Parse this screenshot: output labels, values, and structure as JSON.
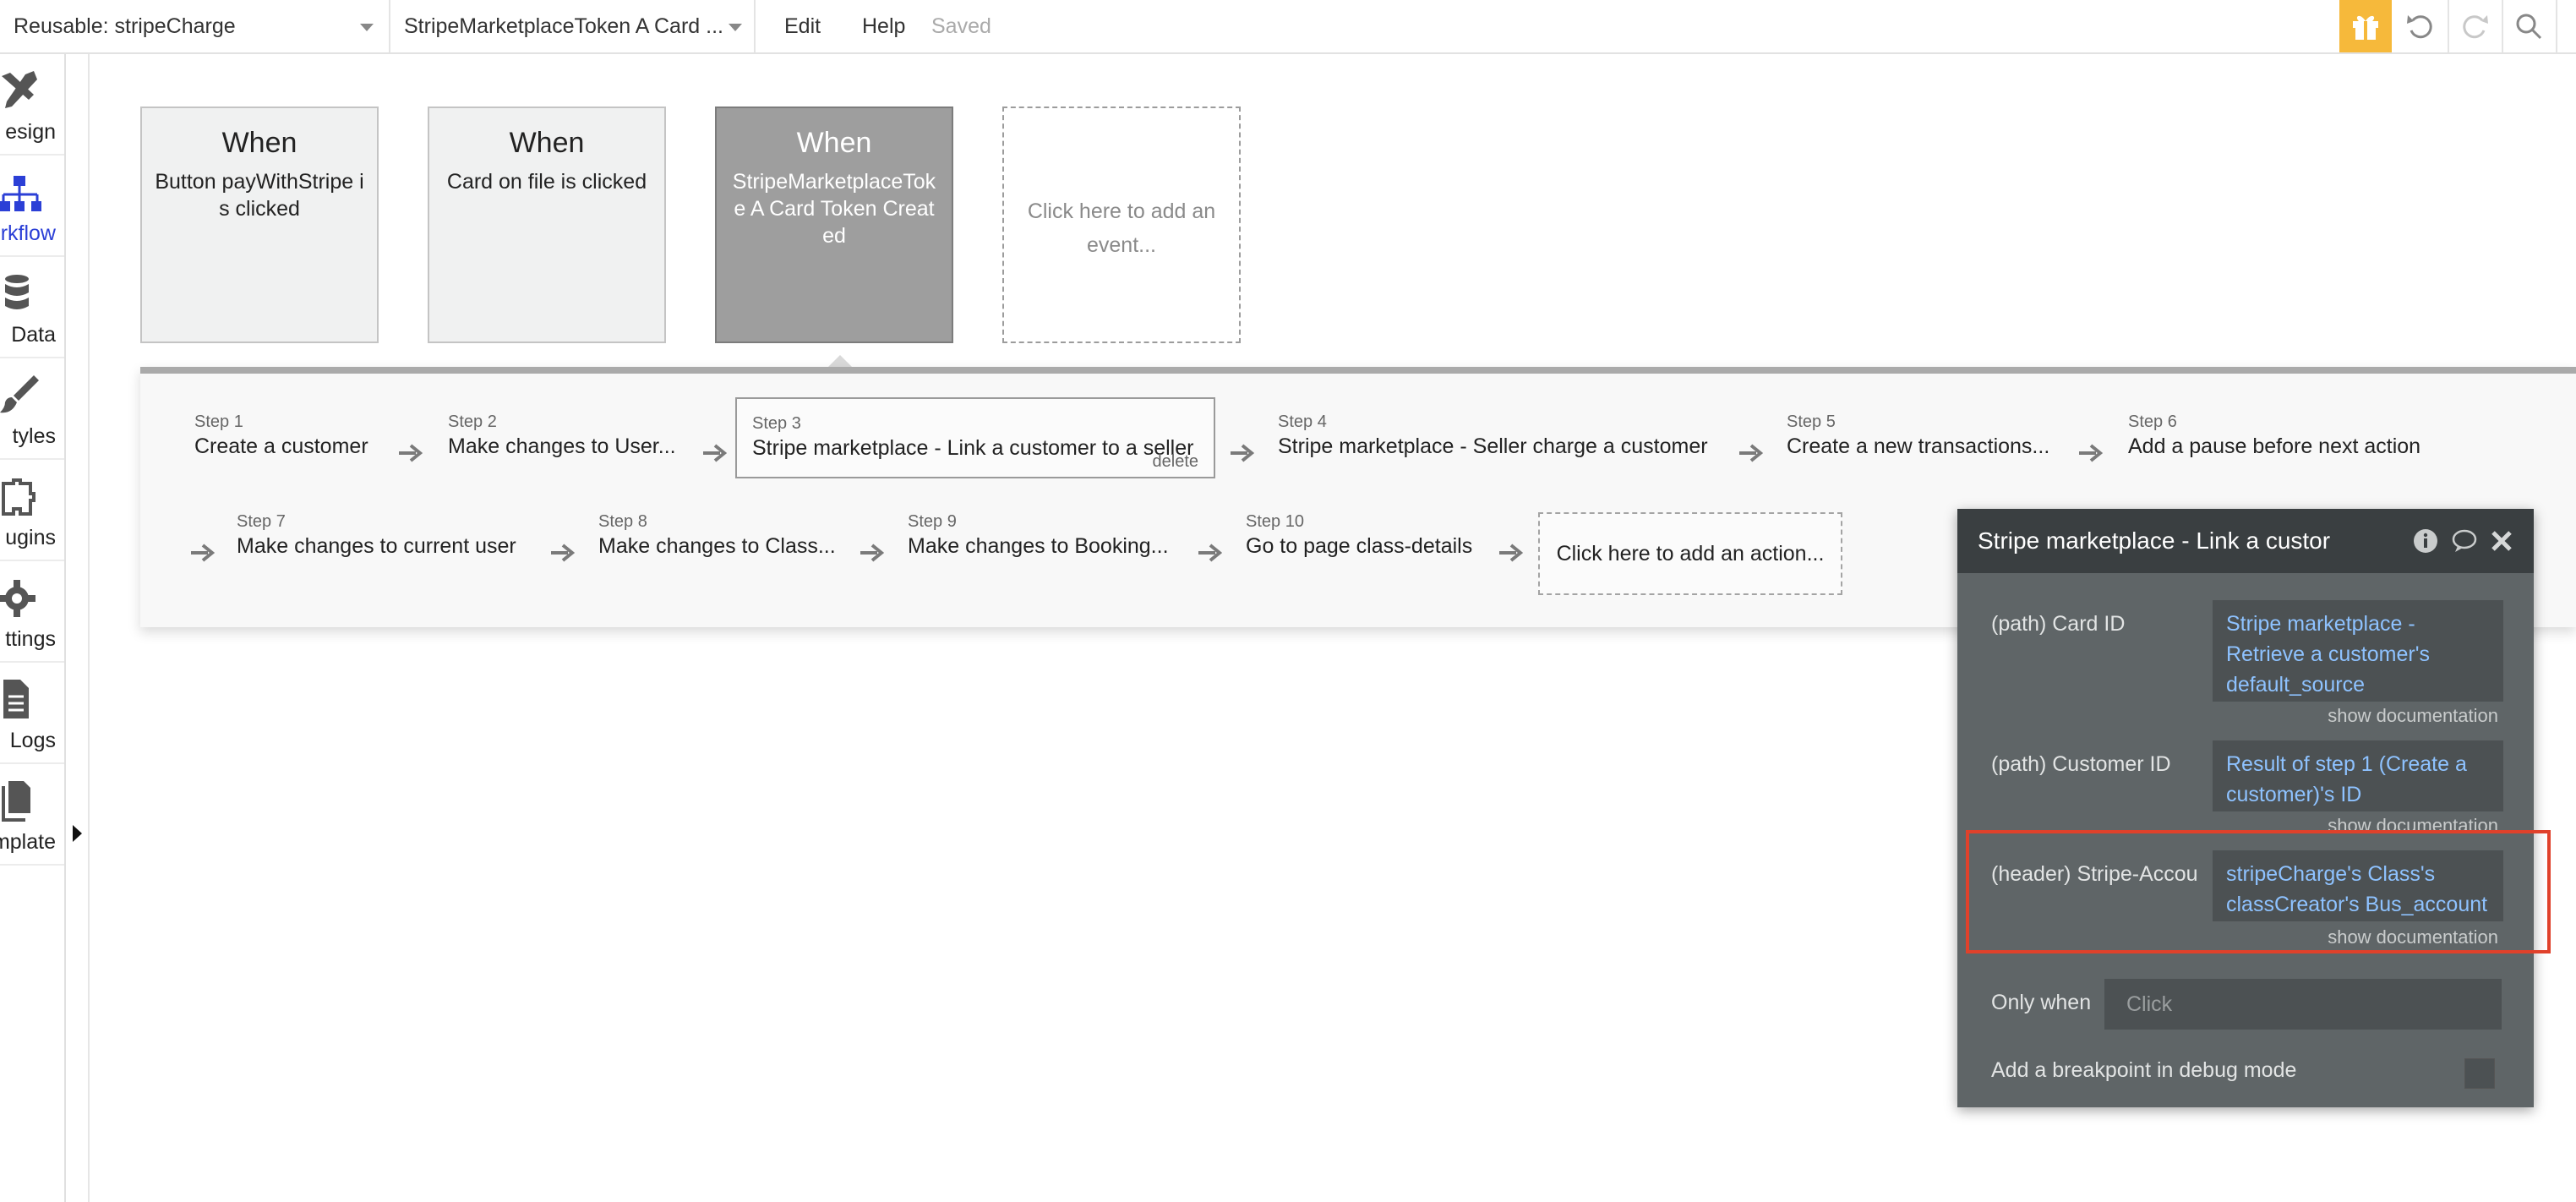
{
  "topbar": {
    "page_dropdown": "Reusable: stripeCharge",
    "event_dropdown": "StripeMarketplaceToken A Card ...",
    "menu_edit": "Edit",
    "menu_help": "Help",
    "status": "Saved",
    "accent_color": "#f6b93b"
  },
  "sidebar": {
    "items": [
      {
        "label": "esign",
        "icon": "design-icon"
      },
      {
        "label": "rkflow",
        "icon": "workflow-icon"
      },
      {
        "label": "Data",
        "icon": "data-icon"
      },
      {
        "label": "tyles",
        "icon": "styles-icon"
      },
      {
        "label": "ugins",
        "icon": "plugins-icon"
      },
      {
        "label": "ttings",
        "icon": "settings-icon"
      },
      {
        "label": "Logs",
        "icon": "logs-icon"
      },
      {
        "label": "mplate",
        "icon": "template-icon"
      }
    ]
  },
  "events": [
    {
      "when": "When",
      "desc": "Button payWithStripe is clicked"
    },
    {
      "when": "When",
      "desc": "Card on file is clicked"
    },
    {
      "when": "When",
      "desc": "StripeMarketplaceToke A Card Token Created"
    },
    {
      "desc": "Click here to add an event..."
    }
  ],
  "steps": [
    {
      "num": "Step 1",
      "title": "Create a customer"
    },
    {
      "num": "Step 2",
      "title": "Make changes to User..."
    },
    {
      "num": "Step 3",
      "title": "Stripe marketplace - Link a customer to a seller",
      "delete": "delete"
    },
    {
      "num": "Step 4",
      "title": "Stripe marketplace - Seller charge a customer"
    },
    {
      "num": "Step 5",
      "title": "Create a new transactions..."
    },
    {
      "num": "Step 6",
      "title": "Add a pause before next action"
    },
    {
      "num": "Step 7",
      "title": "Make changes to current user"
    },
    {
      "num": "Step 8",
      "title": "Make changes to Class..."
    },
    {
      "num": "Step 9",
      "title": "Make changes to Booking..."
    },
    {
      "num": "Step 10",
      "title": "Go to page class-details"
    }
  ],
  "add_action": "Click here to add an action...",
  "property_editor": {
    "title": "Stripe marketplace - Link a custor",
    "fields": [
      {
        "label": "(path) Card ID",
        "value": "Stripe marketplace - Retrieve a customer's default_source",
        "doc": "show documentation"
      },
      {
        "label": "(path) Customer ID",
        "value": "Result of step 1 (Create a customer)'s ID",
        "doc": "show documentation"
      },
      {
        "label": "(header) Stripe-Accou",
        "value": "stripeCharge's Class's classCreator's Bus_account",
        "doc": "show documentation"
      }
    ],
    "only_when_label": "Only when",
    "only_when_placeholder": "Click",
    "breakpoint_label": "Add a breakpoint in debug mode",
    "link_color": "#8ec2ff",
    "highlight_color": "#e0412b"
  }
}
